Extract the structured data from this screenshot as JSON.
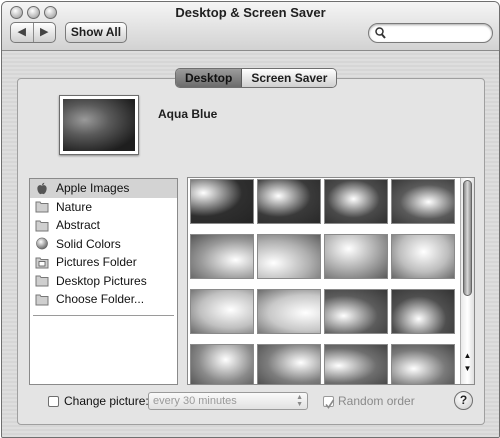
{
  "window": {
    "title": "Desktop & Screen Saver"
  },
  "toolbar": {
    "back_icon": "back-arrow-icon",
    "forward_icon": "forward-arrow-icon",
    "show_all_label": "Show All",
    "search_value": "",
    "search_icon": "magnifier-icon"
  },
  "tabs": [
    {
      "label": "Desktop",
      "selected": true
    },
    {
      "label": "Screen Saver",
      "selected": false
    }
  ],
  "current": {
    "name": "Aqua Blue"
  },
  "sources": [
    {
      "label": "Apple Images",
      "icon": "apple-icon",
      "selected": true
    },
    {
      "label": "Nature",
      "icon": "folder-icon",
      "selected": false
    },
    {
      "label": "Abstract",
      "icon": "folder-icon",
      "selected": false
    },
    {
      "label": "Solid Colors",
      "icon": "sphere-icon",
      "selected": false
    },
    {
      "label": "Pictures Folder",
      "icon": "pictures-folder-icon",
      "selected": false
    },
    {
      "label": "Desktop Pictures",
      "icon": "folder-icon",
      "selected": false
    },
    {
      "label": "Choose Folder...",
      "icon": "folder-icon",
      "selected": false
    }
  ],
  "thumbnails": {
    "rows": 4,
    "columns": 4,
    "tones": [
      "#2f2f2f",
      "#3a3a3a",
      "#4a4a4a",
      "#5a5a5a",
      "#9a9a9a",
      "#b0b0b0",
      "#a6a6a6",
      "#bdbdbd",
      "#c0c0c0",
      "#c8c8c8",
      "#5c5c5c",
      "#4f4f4f",
      "#8a8a8a",
      "#7d7d7d",
      "#6e6e6e",
      "#7a7a7a"
    ]
  },
  "scrollbar": {
    "up_icon": "scroll-up-arrow-icon",
    "down_icon": "scroll-down-arrow-icon"
  },
  "options": {
    "change_picture_label": "Change picture:",
    "change_picture_checked": false,
    "interval_value": "every 30 minutes",
    "random_order_label": "Random order",
    "random_order_checked": true,
    "help_label": "?"
  },
  "colors": {
    "window_bg": "#d9d9d9",
    "selected_row": "#d3d3d3",
    "tab_selected": "#7a7a7a"
  }
}
